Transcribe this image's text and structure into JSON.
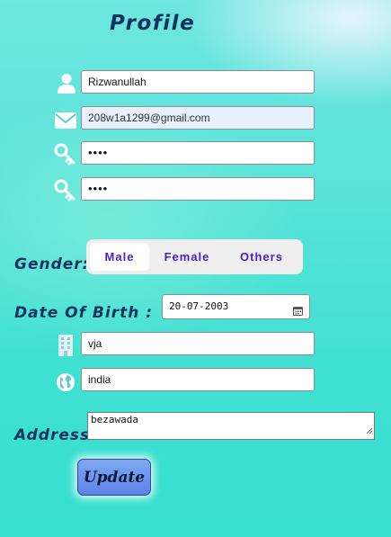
{
  "header": {
    "title": "Profile"
  },
  "form": {
    "name": {
      "value": "Rizwanullah",
      "icon": "user-icon"
    },
    "email": {
      "value": "208w1a1299@gmail.com",
      "icon": "mail-icon"
    },
    "password": {
      "value": "••••",
      "icon": "key-icon"
    },
    "confirm_password": {
      "value": "••••",
      "icon": "key-icon"
    },
    "gender": {
      "label": "Gender:",
      "options": [
        "Male",
        "Female",
        "Others"
      ],
      "selected": "Male"
    },
    "dob": {
      "label": "Date Of Birth :",
      "value": "20-07-2003",
      "icon": "calendar-icon"
    },
    "city": {
      "value": "vja",
      "icon": "building-icon"
    },
    "country": {
      "value": "india",
      "icon": "globe-icon"
    },
    "address": {
      "label": "Address",
      "value": "bezawada"
    },
    "submit_label": "Update"
  },
  "colors": {
    "heading": "#13335f",
    "accent_text": "#4b20c7",
    "button": "#6a8fea"
  }
}
